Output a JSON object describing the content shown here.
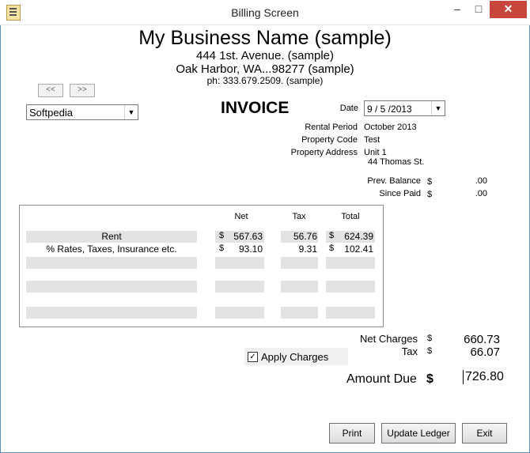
{
  "window": {
    "title": "Billing Screen",
    "minimize": "–",
    "maximize": "□",
    "close": "✕"
  },
  "header": {
    "business_name": "My Business Name (sample)",
    "address_line1": "444 1st. Avenue. (sample)",
    "address_line2": "Oak Harbor, WA...98277 (sample)",
    "phone": "ph: 333.679.2509. (sample)"
  },
  "nav": {
    "prev": "<<",
    "next": ">>"
  },
  "customer": {
    "selected": "Softpedia"
  },
  "invoice": {
    "title": "INVOICE",
    "date_label": "Date",
    "date_value": "9 / 5 /2013",
    "rental_period_label": "Rental Period",
    "rental_period_value": "October  2013",
    "property_code_label": "Property Code",
    "property_code_value": "Test",
    "property_address_label": "Property Address",
    "property_address_line1": "Unit 1",
    "property_address_line2": "44 Thomas St.",
    "prev_balance_label": "Prev. Balance",
    "prev_balance_currency": "$",
    "prev_balance_value": ".00",
    "since_paid_label": "Since Paid",
    "since_paid_currency": "$",
    "since_paid_value": ".00"
  },
  "charges": {
    "headers": {
      "net": "Net",
      "tax": "Tax",
      "total": "Total"
    },
    "rows": [
      {
        "desc": "Rent",
        "net_cur": "$",
        "net": "567.63",
        "tax": "56.76",
        "total_cur": "$",
        "total": "624.39"
      },
      {
        "desc": "% Rates, Taxes, Insurance etc.",
        "net_cur": "$",
        "net": "93.10",
        "tax": "9.31",
        "total_cur": "$",
        "total": "102.41"
      }
    ]
  },
  "totals": {
    "net_charges_label": "Net Charges",
    "net_charges_currency": "$",
    "net_charges_value": "660.73",
    "tax_label": "Tax",
    "tax_currency": "$",
    "tax_value": "66.07",
    "amount_due_label": "Amount Due",
    "amount_due_currency": "$",
    "amount_due_value": "726.80",
    "apply_charges_label": "Apply Charges",
    "apply_charges_checked": "✓"
  },
  "buttons": {
    "print": "Print",
    "update_ledger": "Update Ledger",
    "exit": "Exit"
  }
}
